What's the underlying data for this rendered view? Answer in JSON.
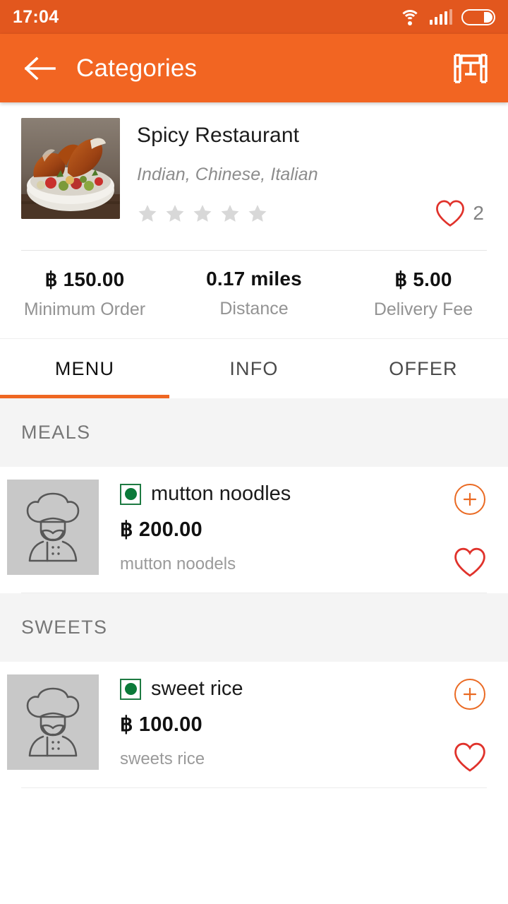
{
  "status_bar": {
    "time": "17:04",
    "icons": [
      "wifi-icon",
      "signal-icon",
      "battery-icon"
    ]
  },
  "app_bar": {
    "back_icon": "back-arrow-icon",
    "title": "Categories",
    "action_icon": "dining-table-icon",
    "background_color": "#f26522"
  },
  "restaurant": {
    "thumbnail_alt": "roasted-chicken-bowl",
    "name": "Spicy Restaurant",
    "cuisines": "Indian, Chinese, Italian",
    "rating": 0,
    "stars_total": 5,
    "star_color": "#d8d8d8",
    "favorite_icon": "heart-outline-icon",
    "favorite_count": "2",
    "favorite_color": "#e0322b"
  },
  "stats": [
    {
      "value": "฿ 150.00",
      "label": "Minimum Order"
    },
    {
      "value": "0.17 miles",
      "label": "Distance"
    },
    {
      "value": "฿ 5.00",
      "label": "Delivery Fee"
    }
  ],
  "tabs": [
    {
      "label": "MENU",
      "active": true
    },
    {
      "label": "INFO",
      "active": false
    },
    {
      "label": "OFFER",
      "active": false
    }
  ],
  "tab_indicator_color": "#ef6722",
  "menu_sections": [
    {
      "title": "MEALS",
      "items": [
        {
          "thumb_icon": "chef-placeholder-icon",
          "veg_indicator": "veg-green-dot-icon",
          "name": "mutton noodles",
          "price": "฿ 200.00",
          "description": "mutton noodels",
          "add_icon": "plus-circle-icon",
          "favorite_icon": "heart-outline-icon"
        }
      ]
    },
    {
      "title": "SWEETS",
      "items": [
        {
          "thumb_icon": "chef-placeholder-icon",
          "veg_indicator": "veg-green-dot-icon",
          "name": "sweet rice",
          "price": "฿ 100.00",
          "description": "sweets rice",
          "add_icon": "plus-circle-icon",
          "favorite_icon": "heart-outline-icon"
        }
      ]
    }
  ]
}
